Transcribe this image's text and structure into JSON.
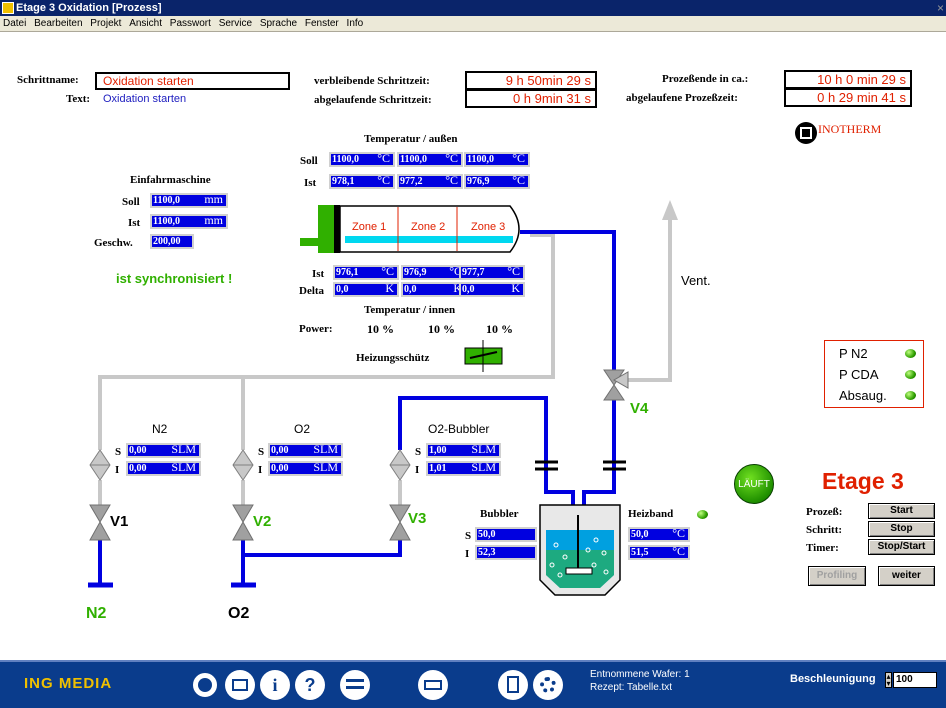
{
  "window": {
    "title": "Etage 3 Oxidation [Prozess]",
    "close": "×"
  },
  "menu": [
    "Datei",
    "Bearbeiten",
    "Projekt",
    "Ansicht",
    "Passwort",
    "Service",
    "Sprache",
    "Fenster",
    "Info"
  ],
  "step": {
    "name_label": "Schrittname:",
    "name_value": "Oxidation starten",
    "text_label": "Text:",
    "text_value": "Oxidation starten"
  },
  "times": {
    "remaining_step_label": "verbleibende Schrittzeit:",
    "remaining_step_value": "9 h  50min  29 s",
    "elapsed_step_label": "abgelaufende Schrittzeit:",
    "elapsed_step_value": "0 h   9min  31 s",
    "process_end_label": "Prozeßende in ca.:",
    "process_end_value": "10 h    0 min  29 s",
    "elapsed_process_label": "abgelaufene Prozeßzeit:",
    "elapsed_process_value": "0 h  29 min  41 s"
  },
  "brand": {
    "name": "INOTHERM"
  },
  "temp_outer": {
    "title": "Temperatur / außen",
    "soll_label": "Soll",
    "ist_label": "Ist",
    "soll": [
      "1100,0",
      "1100,0",
      "1100,0"
    ],
    "ist": [
      "978,1",
      "977,2",
      "976,9"
    ],
    "unit": "°C"
  },
  "einfahr": {
    "title": "Einfahrmaschine",
    "soll_label": "Soll",
    "soll": "1100,0",
    "ist_label": "Ist",
    "ist": "1100,0",
    "unit": "mm",
    "speed_label": "Geschw.",
    "speed": "200,00",
    "sync_text": "ist synchronisiert !"
  },
  "zones": [
    "Zone 1",
    "Zone 2",
    "Zone 3"
  ],
  "temp_inner": {
    "ist_label": "Ist",
    "delta_label": "Delta",
    "ist": [
      "976,1",
      "976,9",
      "977,7"
    ],
    "delta": [
      "0,0",
      "0,0",
      "0,0"
    ],
    "unit_c": "°C",
    "unit_k": "K",
    "title": "Temperatur / innen",
    "power_label": "Power:",
    "power": [
      "10 %",
      "10 %",
      "10 %"
    ],
    "heater_label": "Heizungsschütz"
  },
  "vent_label": "Vent.",
  "pressure": {
    "items": [
      "P N2",
      "P CDA",
      "Absaug."
    ]
  },
  "mfc": {
    "n2": {
      "title": "N2",
      "s": "0,00",
      "i": "0,00",
      "unit": "SLM"
    },
    "o2": {
      "title": "O2",
      "s": "0,00",
      "i": "0,00",
      "unit": "SLM"
    },
    "bubbler": {
      "title": "O2-Bubbler",
      "s": "1,00",
      "i": "1,01",
      "unit": "SLM"
    },
    "s_label": "S",
    "i_label": "I"
  },
  "valves": {
    "v1": "V1",
    "v2": "V2",
    "v3": "V3",
    "v4": "V4"
  },
  "sources": {
    "n2": "N2",
    "o2": "O2"
  },
  "bubbler": {
    "title": "Bubbler",
    "s_label": "S",
    "s": "50,0",
    "i_label": "I",
    "i": "52,3"
  },
  "heizband": {
    "title": "Heizband",
    "s": "50,0",
    "i": "51,5",
    "unit": "°C"
  },
  "status": {
    "running": "LÄUFT",
    "stage": "Etage 3"
  },
  "controls": {
    "process_label": "Prozeß:",
    "process_btn": "Start",
    "step_label": "Schritt:",
    "step_btn": "Stop",
    "timer_label": "Timer:",
    "timer_btn": "Stop/Start",
    "profiling": "Profiling",
    "weiter": "weiter"
  },
  "footer": {
    "logo": "ING MEDIA",
    "wafer": "Entnommene Wafer: 1",
    "recipe": "Rezept: Tabelle.txt",
    "accel_label": "Beschleunigung",
    "accel_value": "100"
  },
  "colors": {
    "blue_pipe": "#0000e0",
    "gray_pipe": "#c8c8c8",
    "red": "#e02000",
    "green": "#30b000"
  }
}
